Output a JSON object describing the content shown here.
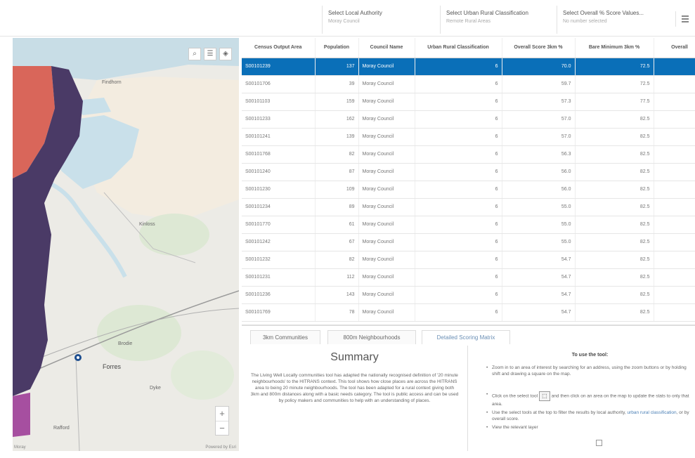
{
  "filters": [
    {
      "label": "Select Local Authority",
      "value": "Moray Council"
    },
    {
      "label": "Select Urban Rural Classification",
      "value": "Remote Rural Areas"
    },
    {
      "label": "Select Overall % Score Values...",
      "value": "No number selected"
    }
  ],
  "map": {
    "places": [
      "Findhorn",
      "Kinloss",
      "Forres",
      "Brodie",
      "Dyke",
      "Rafford"
    ],
    "attribution": "Moray",
    "powered_by": "Powered by Esri",
    "zoom_in": "+",
    "zoom_out": "−",
    "tools": [
      "search-icon",
      "list-icon",
      "layers-icon"
    ],
    "colors": {
      "red_zone": "#d9665a",
      "purple_zone": "#4a3a66",
      "pink_zone": "#a64fa0",
      "water": "#c3dce8",
      "land": "#f1ece0"
    }
  },
  "table": {
    "columns": [
      "Census Output Area",
      "Population",
      "Council Name",
      "Urban Rural Classification",
      "Overall Score 3km %",
      "Bare Minimum 3km %",
      "Overall"
    ],
    "rows": [
      {
        "area": "S00101239",
        "population": "137",
        "council": "Moray Council",
        "urc": "6",
        "overall": "70.0",
        "bare": "72.5",
        "selected": true
      },
      {
        "area": "S00101706",
        "population": "39",
        "council": "Moray Council",
        "urc": "6",
        "overall": "59.7",
        "bare": "72.5",
        "selected": false
      },
      {
        "area": "S00101103",
        "population": "159",
        "council": "Moray Council",
        "urc": "6",
        "overall": "57.3",
        "bare": "77.5",
        "selected": false
      },
      {
        "area": "S00101233",
        "population": "162",
        "council": "Moray Council",
        "urc": "6",
        "overall": "57.0",
        "bare": "82.5",
        "selected": false
      },
      {
        "area": "S00101241",
        "population": "139",
        "council": "Moray Council",
        "urc": "6",
        "overall": "57.0",
        "bare": "82.5",
        "selected": false
      },
      {
        "area": "S00101768",
        "population": "82",
        "council": "Moray Council",
        "urc": "6",
        "overall": "56.3",
        "bare": "82.5",
        "selected": false
      },
      {
        "area": "S00101240",
        "population": "87",
        "council": "Moray Council",
        "urc": "6",
        "overall": "56.0",
        "bare": "82.5",
        "selected": false
      },
      {
        "area": "S00101230",
        "population": "109",
        "council": "Moray Council",
        "urc": "6",
        "overall": "56.0",
        "bare": "82.5",
        "selected": false
      },
      {
        "area": "S00101234",
        "population": "89",
        "council": "Moray Council",
        "urc": "6",
        "overall": "55.0",
        "bare": "82.5",
        "selected": false
      },
      {
        "area": "S00101770",
        "population": "61",
        "council": "Moray Council",
        "urc": "6",
        "overall": "55.0",
        "bare": "82.5",
        "selected": false
      },
      {
        "area": "S00101242",
        "population": "67",
        "council": "Moray Council",
        "urc": "6",
        "overall": "55.0",
        "bare": "82.5",
        "selected": false
      },
      {
        "area": "S00101232",
        "population": "82",
        "council": "Moray Council",
        "urc": "6",
        "overall": "54.7",
        "bare": "82.5",
        "selected": false
      },
      {
        "area": "S00101231",
        "population": "112",
        "council": "Moray Council",
        "urc": "6",
        "overall": "54.7",
        "bare": "82.5",
        "selected": false
      },
      {
        "area": "S00101236",
        "population": "143",
        "council": "Moray Council",
        "urc": "6",
        "overall": "54.7",
        "bare": "82.5",
        "selected": false
      },
      {
        "area": "S00101769",
        "population": "78",
        "council": "Moray Council",
        "urc": "6",
        "overall": "54.7",
        "bare": "82.5",
        "selected": false
      }
    ]
  },
  "tabs": [
    "3km Communities",
    "800m Neighbourhoods",
    "Detailed Scoring Matrix"
  ],
  "summary": {
    "title": "Summary",
    "body": "The Living Well Locally communities tool has adapted the nationally recognised definition of '20 minute neighbourhoods' to the HITRANS context. This tool shows how close places are across the HITRANS area to being 20 minute neighbourhoods. The tool has been adapted for a rural context giving both 3km and 800m distances along with a basic needs category. The tool is public access and can be used by policy makers and communities to help with an understanding of places."
  },
  "howto": {
    "title": "To use the tool:",
    "item1": "Zoom in to an area of interest by searching for an address, using the zoom buttons or by holding shift and drawing a square on the map.",
    "item2a": "Click on the select tool",
    "item2b": "and then click on an area on the map to update the stats to only that area.",
    "item3a": "Use the select tools at the top to filter the results by local authority,",
    "item3link": "urban rural classification",
    "item3b": ", or by overall score.",
    "item4": "View the relevant layer"
  }
}
